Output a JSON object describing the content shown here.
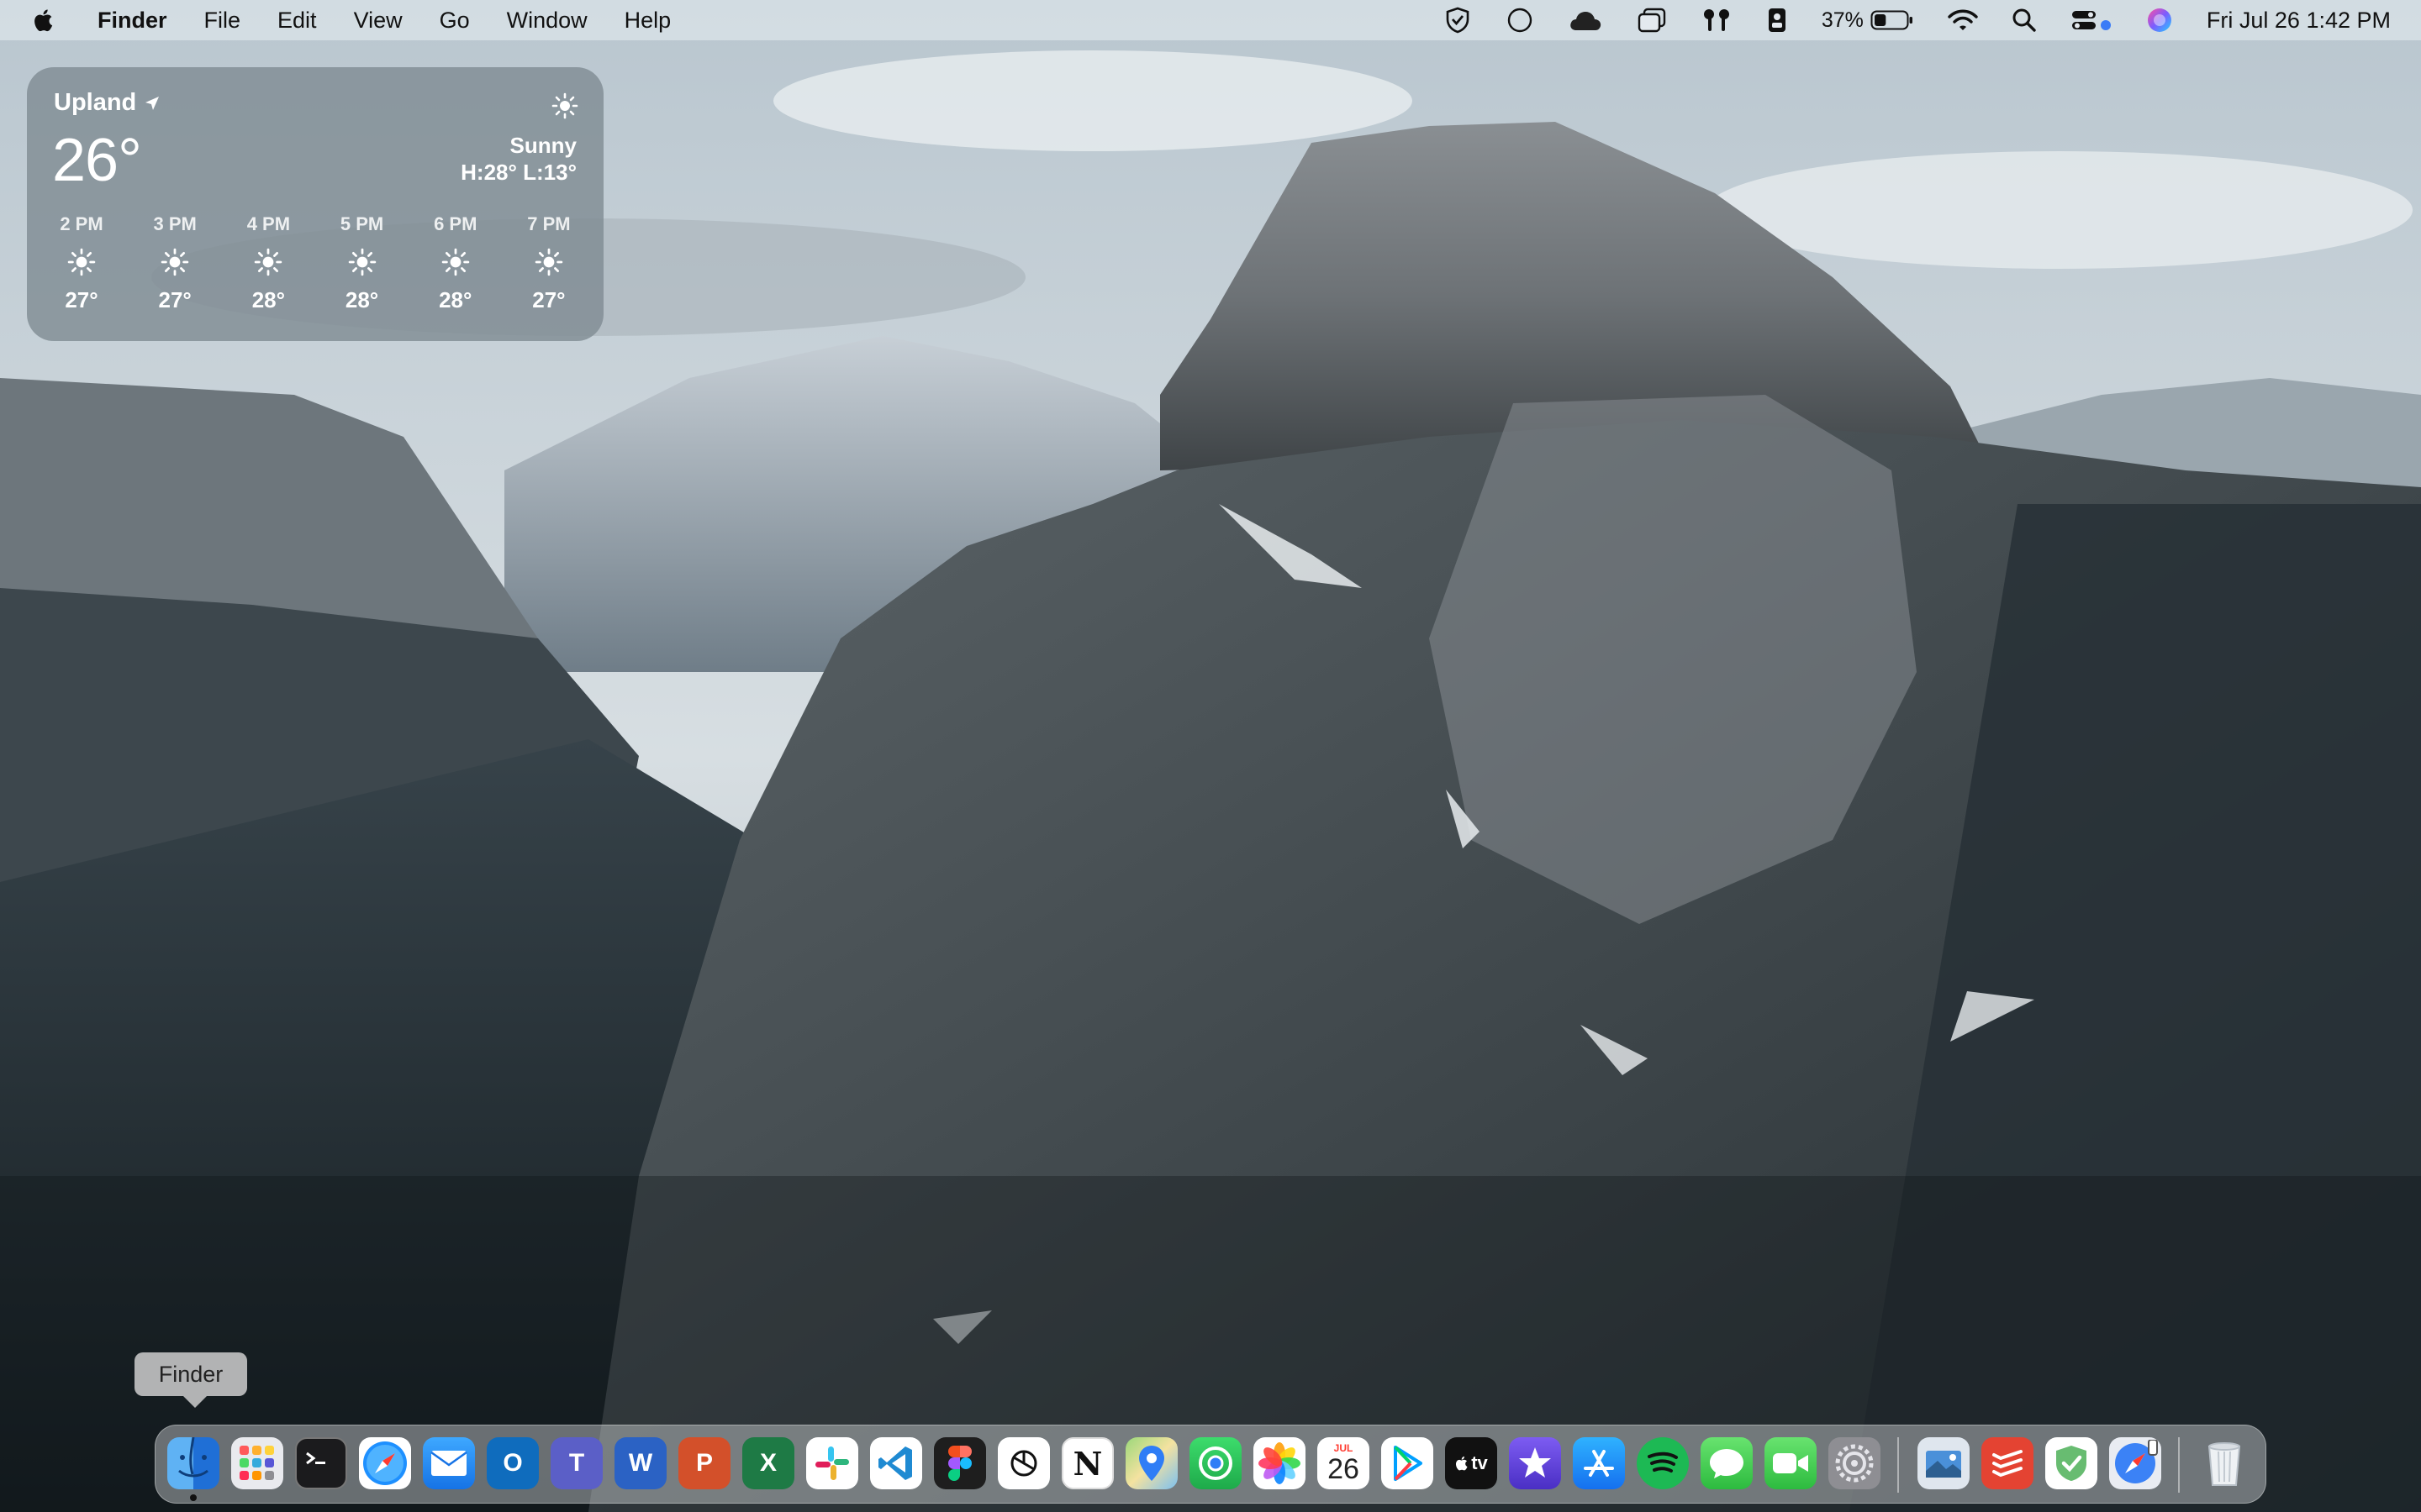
{
  "menubar": {
    "apple_icon": "apple-logo-icon",
    "app_name": "Finder",
    "menus": [
      "File",
      "Edit",
      "View",
      "Go",
      "Window",
      "Help"
    ],
    "status_icons": [
      "shield-check-icon",
      "circle-icon",
      "cloud-icon",
      "stacked-windows-icon",
      "airpods-icon",
      "id-card-icon"
    ],
    "battery_percent": "37%",
    "battery_level": 0.37,
    "clock": "Fri Jul 26  1:42 PM"
  },
  "weather": {
    "city": "Upland",
    "temp": "26°",
    "condition": "Sunny",
    "high_low": "H:28° L:13°",
    "hours": [
      {
        "time": "2 PM",
        "temp": "27°"
      },
      {
        "time": "3 PM",
        "temp": "27°"
      },
      {
        "time": "4 PM",
        "temp": "28°"
      },
      {
        "time": "5 PM",
        "temp": "28°"
      },
      {
        "time": "6 PM",
        "temp": "28°"
      },
      {
        "time": "7 PM",
        "temp": "27°"
      }
    ]
  },
  "tooltip": {
    "label": "Finder"
  },
  "dock": {
    "apps": [
      "Finder",
      "Launchpad",
      "Terminal",
      "Safari",
      "Mail",
      "Outlook",
      "Teams",
      "Word",
      "PowerPoint",
      "Excel",
      "Slack",
      "Visual Studio Code",
      "Figma",
      "ChatGPT",
      "Notion",
      "Maps",
      "Find My",
      "Photos",
      "Calendar",
      "Google Play",
      "TV",
      "iMovie",
      "App Store",
      "Spotify",
      "Messages",
      "FaceTime",
      "System Settings",
      "Preview",
      "Todoist",
      "AdGuard",
      "Safari Technology Preview",
      "Trash"
    ],
    "calendar_month": "JUL",
    "calendar_day": "26",
    "tv_label": "tv"
  }
}
